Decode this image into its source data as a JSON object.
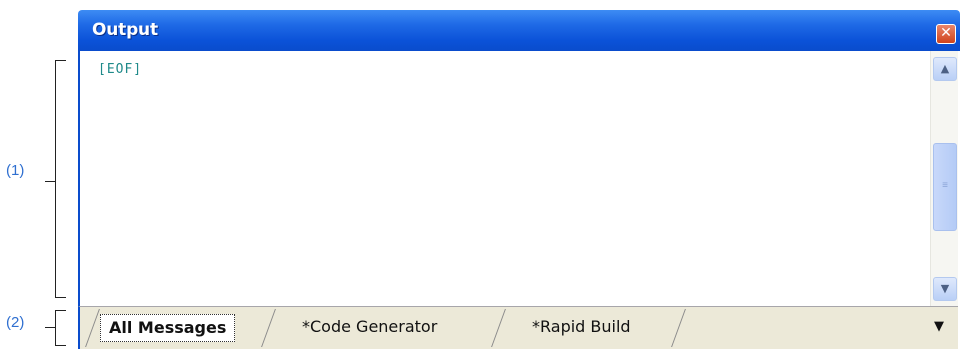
{
  "callouts": {
    "one": "(1)",
    "two": "(2)"
  },
  "window": {
    "title": "Output",
    "close_icon": "close-icon",
    "content_text": "[EOF]"
  },
  "scrollbar": {
    "up_icon": "scroll-up-arrow-icon",
    "down_icon": "scroll-down-arrow-icon",
    "thumb_icon": "scroll-thumb-grip-icon"
  },
  "tabs": [
    {
      "label": "All Messages",
      "active": true
    },
    {
      "label": "*Code Generator",
      "active": false
    },
    {
      "label": "*Rapid Build",
      "active": false
    }
  ],
  "tabbar": {
    "menu_icon": "dropdown-arrow-icon"
  },
  "colors": {
    "titlebar": "#0b52d8",
    "close_button": "#d0431c",
    "eof_text": "#1f8a8a",
    "callout_text": "#2f6fd0",
    "tabbar_bg": "#ece9d8"
  }
}
